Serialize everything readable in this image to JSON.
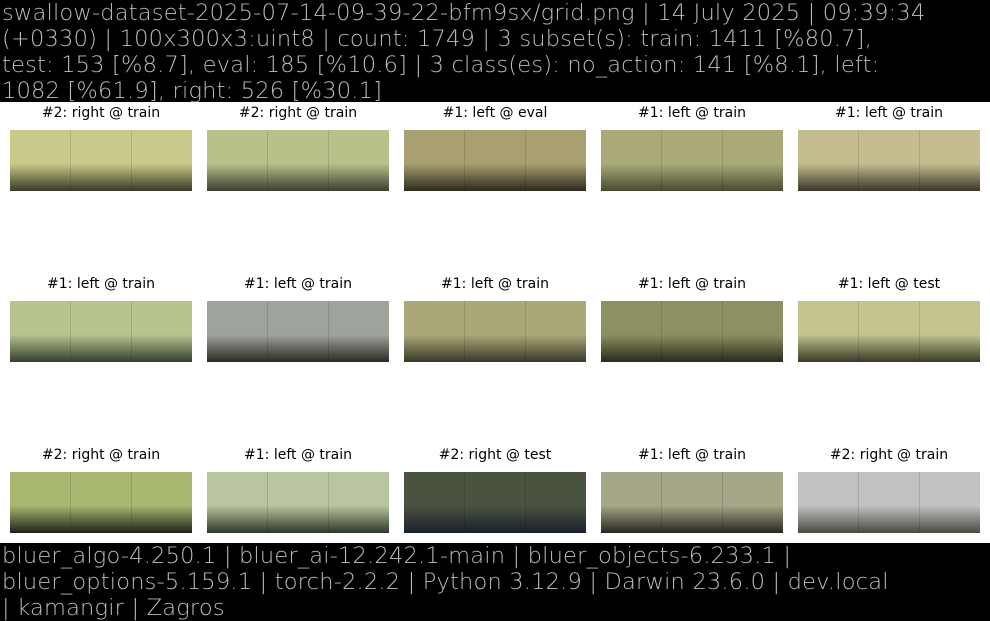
{
  "header": {
    "lines": [
      "swallow-dataset-2025-07-14-09-39-22-bfm9sx/grid.png | 14 July 2025 | 09:39:34",
      "(+0330) | 100x300x3:uint8 | count: 1749 | 3 subset(s): train: 1411 [%80.7],",
      "test: 153 [%8.7], eval: 185 [%10.6] | 3 class(es): no_action: 141 [%8.1], left:",
      "1082 [%61.9], right: 526 [%30.1]"
    ]
  },
  "grid": {
    "tiles": [
      {
        "caption": "#2: right @ train",
        "colors": [
          "#c9c98a",
          "#3a3a28"
        ]
      },
      {
        "caption": "#2: right @ train",
        "colors": [
          "#b9c08a",
          "#3a4030"
        ]
      },
      {
        "caption": "#1: left @ eval",
        "colors": [
          "#a8a070",
          "#2c2a1e"
        ]
      },
      {
        "caption": "#1: left @ train",
        "colors": [
          "#a9aa78",
          "#4a4a30"
        ]
      },
      {
        "caption": "#1: left @ train",
        "colors": [
          "#c3bd90",
          "#3e3628"
        ]
      },
      {
        "caption": "#1: left @ train",
        "colors": [
          "#b7c490",
          "#34402a"
        ]
      },
      {
        "caption": "#1: left @ train",
        "colors": [
          "#9ea49c",
          "#2c2a24"
        ]
      },
      {
        "caption": "#1: left @ train",
        "colors": [
          "#aaa878",
          "#3a3a28"
        ]
      },
      {
        "caption": "#1: left @ train",
        "colors": [
          "#8d9060",
          "#2a2a1c"
        ]
      },
      {
        "caption": "#1: left @ test",
        "colors": [
          "#c3c48e",
          "#3a3a28"
        ]
      },
      {
        "caption": "#2: right @ train",
        "colors": [
          "#a8b870",
          "#1e2218"
        ]
      },
      {
        "caption": "#1: left @ train",
        "colors": [
          "#b9c4a0",
          "#303828"
        ]
      },
      {
        "caption": "#2: right @ test",
        "colors": [
          "#4a5240",
          "#1a2030"
        ]
      },
      {
        "caption": "#1: left @ train",
        "colors": [
          "#a6a688",
          "#262620"
        ]
      },
      {
        "caption": "#2: right @ train",
        "colors": [
          "#c0c2c0",
          "#4a4a40"
        ]
      }
    ]
  },
  "footer": {
    "lines": [
      "bluer_algo-4.250.1 | bluer_ai-12.242.1-main | bluer_objects-6.233.1 |",
      "bluer_options-5.159.1 | torch-2.2.2 | Python 3.12.9 | Darwin 23.6.0 | dev.local",
      "| kamangir | Zagros"
    ]
  }
}
